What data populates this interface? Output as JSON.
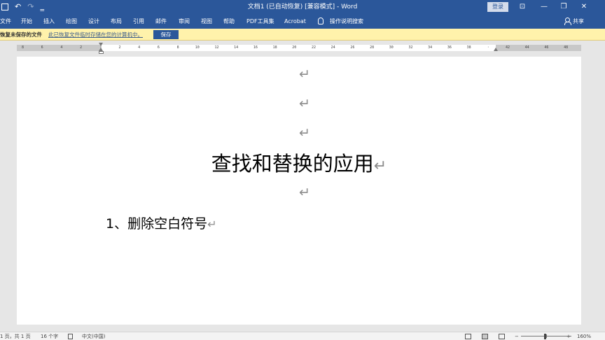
{
  "window": {
    "title": "文档1 (已自动恢复) [兼容模式] - Word",
    "sign_in": "登录",
    "share": "共享",
    "buttons": [
      "⊡",
      "—",
      "❐",
      "✕"
    ]
  },
  "quick_access": {
    "undo": "↶",
    "redo": "↷",
    "customize": "‗"
  },
  "ribbon_tabs": [
    "文件",
    "开始",
    "插入",
    "绘图",
    "设计",
    "布局",
    "引用",
    "邮件",
    "审阅",
    "视图",
    "帮助",
    "PDF工具集",
    "Acrobat"
  ],
  "tell_me": "操作说明搜索",
  "message_bar": {
    "title": "恢复未保存的文件",
    "text": "此已恢复文件临时存储在您的计算机中。",
    "save_button": "保存"
  },
  "ruler": {
    "ticks": [
      "8",
      "6",
      "4",
      "2",
      "",
      "2",
      "4",
      "6",
      "8",
      "10",
      "12",
      "14",
      "16",
      "18",
      "20",
      "22",
      "24",
      "26",
      "28",
      "30",
      "32",
      "34",
      "36",
      "38",
      "",
      "42",
      "44",
      "46",
      "48"
    ]
  },
  "document": {
    "paragraph_mark": "↵",
    "heading": "查找和替换的应用",
    "item": "1、删除空白符号"
  },
  "status_bar": {
    "page": "1 页，共 1 页",
    "words": "16 个字",
    "language": "中文(中国)",
    "zoom_minus": "−",
    "zoom_plus": "+",
    "zoom": "160%"
  },
  "colors": {
    "accent": "#2b579a",
    "message_bar": "#fff2ab",
    "paragraph_mark": "#8c8c8c"
  }
}
